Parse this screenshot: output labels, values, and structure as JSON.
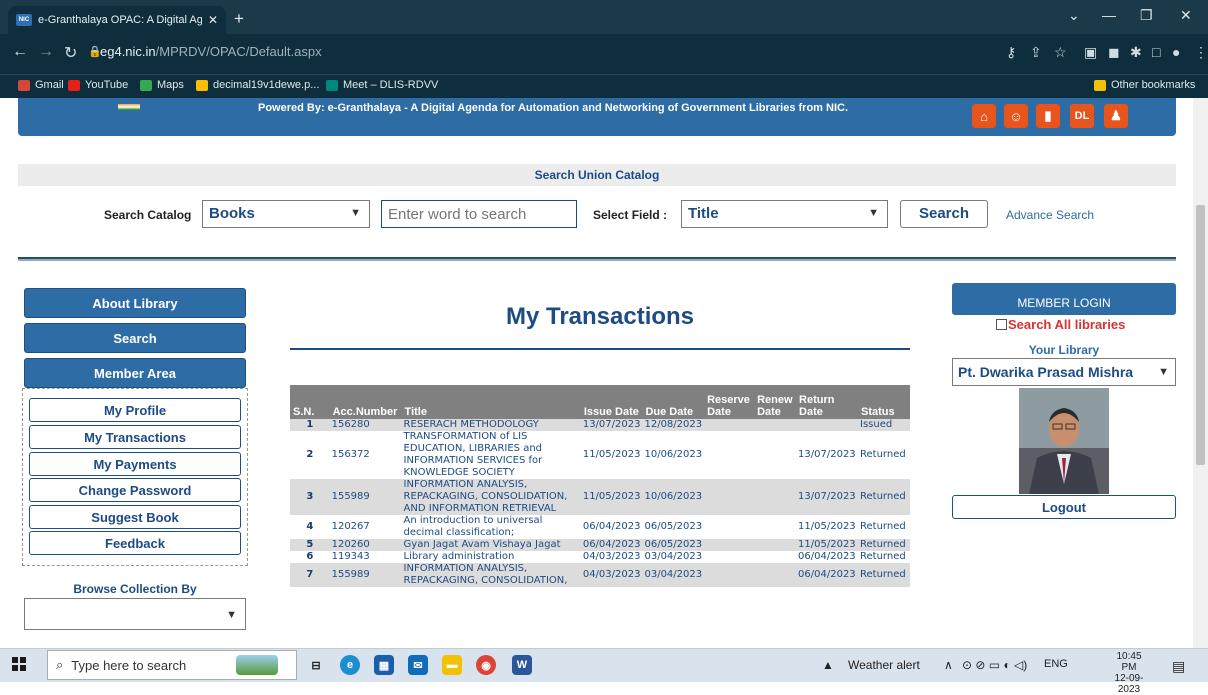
{
  "browser": {
    "tab_title": "e-Granthalaya OPAC: A Digital Ag",
    "tab_favicon": "NIC",
    "url_host": "eg4.nic.in",
    "url_path": "/MPRDV/OPAC/Default.aspx",
    "bookmarks": [
      "Gmail",
      "YouTube",
      "Maps",
      "decimal19v1dewe.p...",
      "Meet – DLIS-RDVV"
    ],
    "other_bookmarks": "Other bookmarks"
  },
  "banner": {
    "powered_by": "Powered By: e-Granthalaya - A Digital Agenda for Automation and Networking of Government Libraries from NIC."
  },
  "search": {
    "panel_title": "Search Union Catalog",
    "catalog_label": "Search Catalog",
    "catalog_value": "Books",
    "input_placeholder": "Enter word to search",
    "field_label": "Select Field :",
    "field_value": "Title",
    "button": "Search",
    "advance": "Advance Search"
  },
  "left_nav": {
    "about": "About Library",
    "search": "Search",
    "member_area": "Member Area",
    "member_items": [
      "My Profile",
      "My Transactions",
      "My Payments",
      "Change Password",
      "Suggest Book",
      "Feedback"
    ],
    "browse_label": "Browse Collection By"
  },
  "main": {
    "title": "My Transactions",
    "columns": [
      "S.N.",
      "Acc.Number",
      "Title",
      "Issue Date",
      "Due Date",
      "Reserve Date",
      "Renew Date",
      "Return Date",
      "Status"
    ],
    "rows": [
      {
        "sn": "1",
        "acc": "156280",
        "title": "RESERACH METHODOLOGY",
        "issue": "13/07/2023",
        "due": "12/08/2023",
        "reserve": "",
        "renew": "",
        "return": "",
        "status": "Issued"
      },
      {
        "sn": "2",
        "acc": "156372",
        "title": "TRANSFORMATION of LIS EDUCATION, LIBRARIES and INFORMATION SERVICES for KNOWLEDGE SOCIETY",
        "issue": "11/05/2023",
        "due": "10/06/2023",
        "reserve": "",
        "renew": "",
        "return": "13/07/2023",
        "status": "Returned"
      },
      {
        "sn": "3",
        "acc": "155989",
        "title": "INFORMATION ANALYSIS, REPACKAGING, CONSOLIDATION, AND INFORMATION RETRIEVAL",
        "issue": "11/05/2023",
        "due": "10/06/2023",
        "reserve": "",
        "renew": "",
        "return": "13/07/2023",
        "status": "Returned"
      },
      {
        "sn": "4",
        "acc": "120267",
        "title": "An introduction to universal decimal classification;",
        "issue": "06/04/2023",
        "due": "06/05/2023",
        "reserve": "",
        "renew": "",
        "return": "11/05/2023",
        "status": "Returned"
      },
      {
        "sn": "5",
        "acc": "120260",
        "title": "Gyan Jagat Avam Vishaya Jagat",
        "issue": "06/04/2023",
        "due": "06/05/2023",
        "reserve": "",
        "renew": "",
        "return": "11/05/2023",
        "status": "Returned"
      },
      {
        "sn": "6",
        "acc": "119343",
        "title": "Library administration",
        "issue": "04/03/2023",
        "due": "03/04/2023",
        "reserve": "",
        "renew": "",
        "return": "06/04/2023",
        "status": "Returned"
      },
      {
        "sn": "7",
        "acc": "155989",
        "title": "INFORMATION ANALYSIS, REPACKAGING, CONSOLIDATION,",
        "issue": "04/03/2023",
        "due": "03/04/2023",
        "reserve": "",
        "renew": "",
        "return": "06/04/2023",
        "status": "Returned"
      }
    ]
  },
  "right_panel": {
    "member_login": "MEMBER LOGIN",
    "search_all": "Search All libraries",
    "your_library": "Your Library",
    "library_value": "Pt. Dwarika Prasad Mishra",
    "logout": "Logout"
  },
  "taskbar": {
    "search_placeholder": "Type here to search",
    "weather": "Weather alert",
    "lang": "ENG",
    "time": "10:45 PM",
    "date": "12-09-2023"
  },
  "colors": {
    "brand_blue": "#2e6ca6",
    "dark_blue": "#1d4b84",
    "table_header": "#808080",
    "alert_red": "#d93333"
  }
}
